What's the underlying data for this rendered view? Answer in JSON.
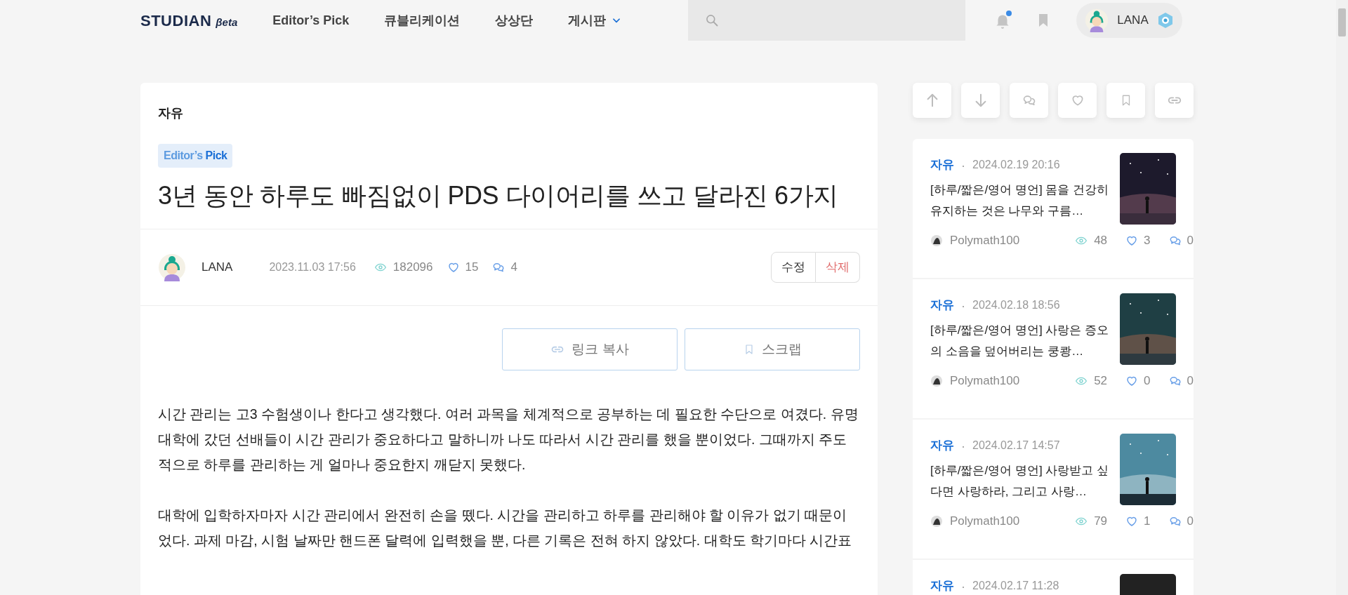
{
  "header": {
    "logo": "STUDIAN",
    "logo_tag": "βeta",
    "nav": [
      {
        "label": "Editor’s Pick",
        "dropdown": false
      },
      {
        "label": "큐블리케이션",
        "dropdown": false
      },
      {
        "label": "상상단",
        "dropdown": false
      },
      {
        "label": "게시판",
        "dropdown": true
      }
    ],
    "notifications": {
      "unread": true
    },
    "profile": {
      "name": "LANA"
    }
  },
  "article": {
    "category": "자유",
    "badge": "Editor’s **Pick**",
    "title": "3년 동안 하루도 빠짐없이 PDS 다이어리를 쓰고 달라진 6가지",
    "author": "LANA",
    "date": "2023.11.03 17:56",
    "views": "182096",
    "likes": "15",
    "comments": "4",
    "edit_actions": [
      {
        "label": "수정",
        "kind": "edit"
      },
      {
        "label": "삭제",
        "kind": "delete"
      }
    ],
    "share_buttons": [
      {
        "label": "링크 복사",
        "kind": "link"
      },
      {
        "label": "스크랩",
        "kind": "bookmark"
      }
    ],
    "paragraphs": [
      "시간 관리는 고3 수험생이나 한다고 생각했다. 여러 과목을 체계적으로 공부하는 데 필요한 수단으로 여겼다. 유명 대학에 갔던 선배들이 시간 관리가 중요하다고 말하니까 나도 따라서 시간 관리를 했을 뿐이었다. 그때까지 주도적으로 하루를 관리하는 게 얼마나 중요한지 깨닫지 못했다.",
      "대학에 입학하자마자 시간 관리에서 완전히 손을 뗐다. 시간을 관리하고 하루를 관리해야 할 이유가 없기 때문이었다. 과제 마감, 시험 날짜만 핸드폰 달력에 입력했을 뿐, 다른 기록은 전혀 하지 않았다. 대학도 학기마다 시간표"
    ]
  },
  "quick_actions": [
    {
      "kind": "up"
    },
    {
      "kind": "down"
    },
    {
      "kind": "comment"
    },
    {
      "kind": "like"
    },
    {
      "kind": "bookmark"
    },
    {
      "kind": "link"
    }
  ],
  "sidebar_posts": [
    {
      "category": "자유",
      "date": "2024.02.19 20:16",
      "title": "[하루/짧은/영어 명언] 몸을 건강히 유지하는 것은 나무와 구름…",
      "author": "Polymath100",
      "views": "48",
      "likes": "3",
      "comments": "0"
    },
    {
      "category": "자유",
      "date": "2024.02.18 18:56",
      "title": "[하루/짧은/영어 명언] 사랑은 증오의 소음을 덮어버리는 쿵쾅…",
      "author": "Polymath100",
      "views": "52",
      "likes": "0",
      "comments": "0"
    },
    {
      "category": "자유",
      "date": "2024.02.17 14:57",
      "title": "[하루/짧은/영어 명언] 사랑받고 싶다면 사랑하라, 그리고 사랑…",
      "author": "Polymath100",
      "views": "79",
      "likes": "1",
      "comments": "0"
    },
    {
      "category": "자유",
      "date": "2024.02.17 11:28"
    }
  ]
}
